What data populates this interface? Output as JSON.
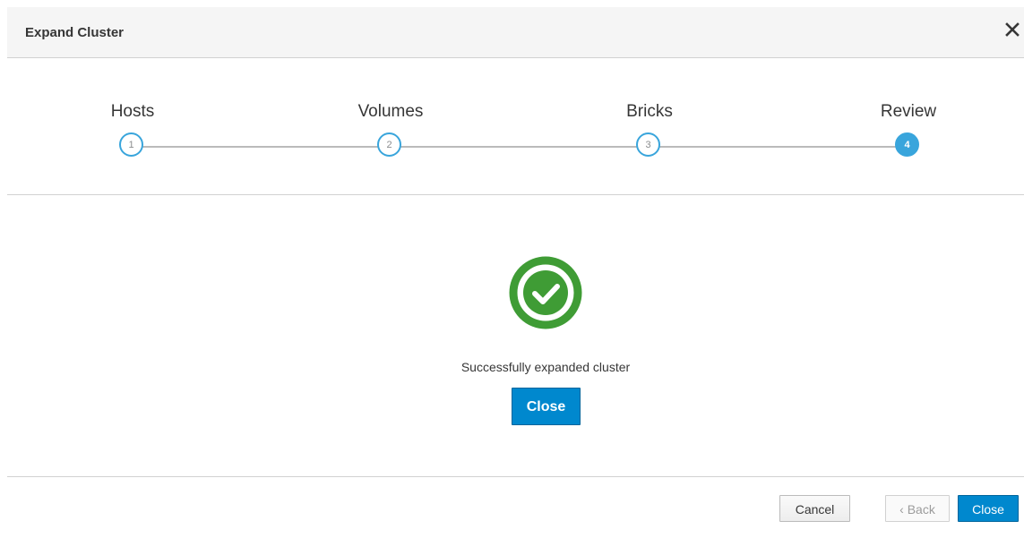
{
  "dialog": {
    "title": "Expand Cluster",
    "close_icon": "close-icon"
  },
  "wizard": {
    "steps": [
      {
        "label": "Hosts",
        "number": "1",
        "state": "completed"
      },
      {
        "label": "Volumes",
        "number": "2",
        "state": "completed"
      },
      {
        "label": "Bricks",
        "number": "3",
        "state": "completed"
      },
      {
        "label": "Review",
        "number": "4",
        "state": "active"
      }
    ]
  },
  "result": {
    "icon": "check-circle-icon",
    "message": "Successfully expanded cluster",
    "close_label": "Close"
  },
  "footer": {
    "cancel_label": "Cancel",
    "back_label": "‹ Back",
    "close_label": "Close"
  },
  "colors": {
    "primary": "#0088ce",
    "step_accent": "#39a5dc",
    "success": "#3f9c35"
  }
}
